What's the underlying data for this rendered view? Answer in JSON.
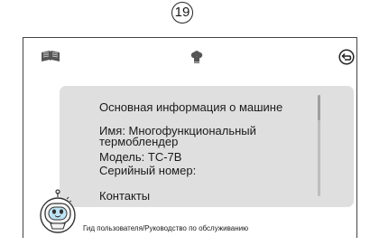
{
  "page_number": "19",
  "toolbar": {
    "left_icon": "book-icon",
    "center_icon": "chef-hat-icon",
    "right_icon": "back-arrow-icon"
  },
  "info_panel": {
    "title": "Основная информация о машине",
    "name_line": "Имя: Многофункциональный термоблендер",
    "model_line": "Модель: TC-7B",
    "serial_line": "Серийный номер:",
    "contacts_label": "Контакты"
  },
  "footer": {
    "assistant_icon": "robot-icon",
    "label": "Гид пользователя/Руководство по обслуживанию"
  },
  "colors": {
    "panel_background": "#dfdfdf",
    "frame_line": "#444444"
  }
}
